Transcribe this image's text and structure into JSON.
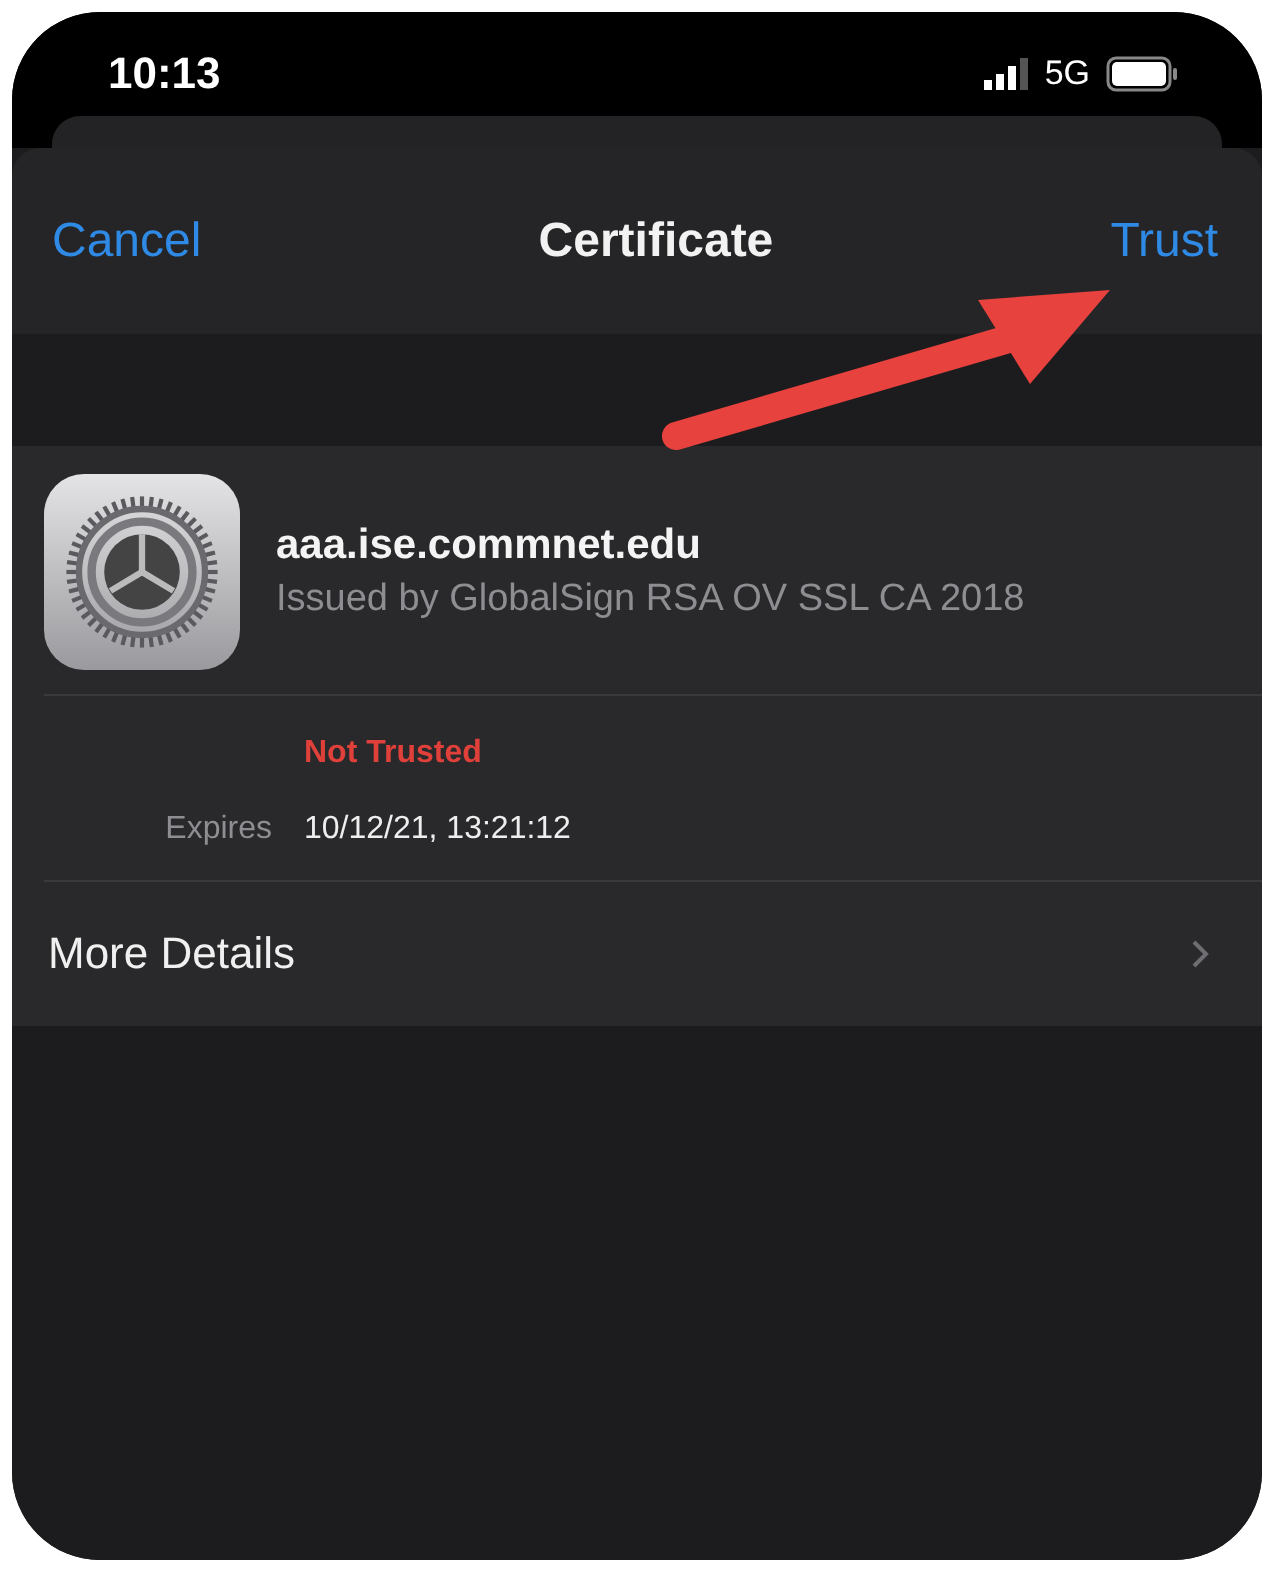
{
  "status_bar": {
    "time": "10:13",
    "network": "5G"
  },
  "nav_bar": {
    "left_button": "Cancel",
    "title": "Certificate",
    "right_button": "Trust"
  },
  "certificate": {
    "name": "aaa.ise.commnet.edu",
    "issuer": "Issued by GlobalSign RSA OV SSL CA 2018",
    "trust_status": "Not Trusted",
    "fields": [
      {
        "label": "Expires",
        "value": "10/12/21, 13:21:12"
      }
    ]
  },
  "rows": [
    {
      "label": "More Details"
    }
  ]
}
